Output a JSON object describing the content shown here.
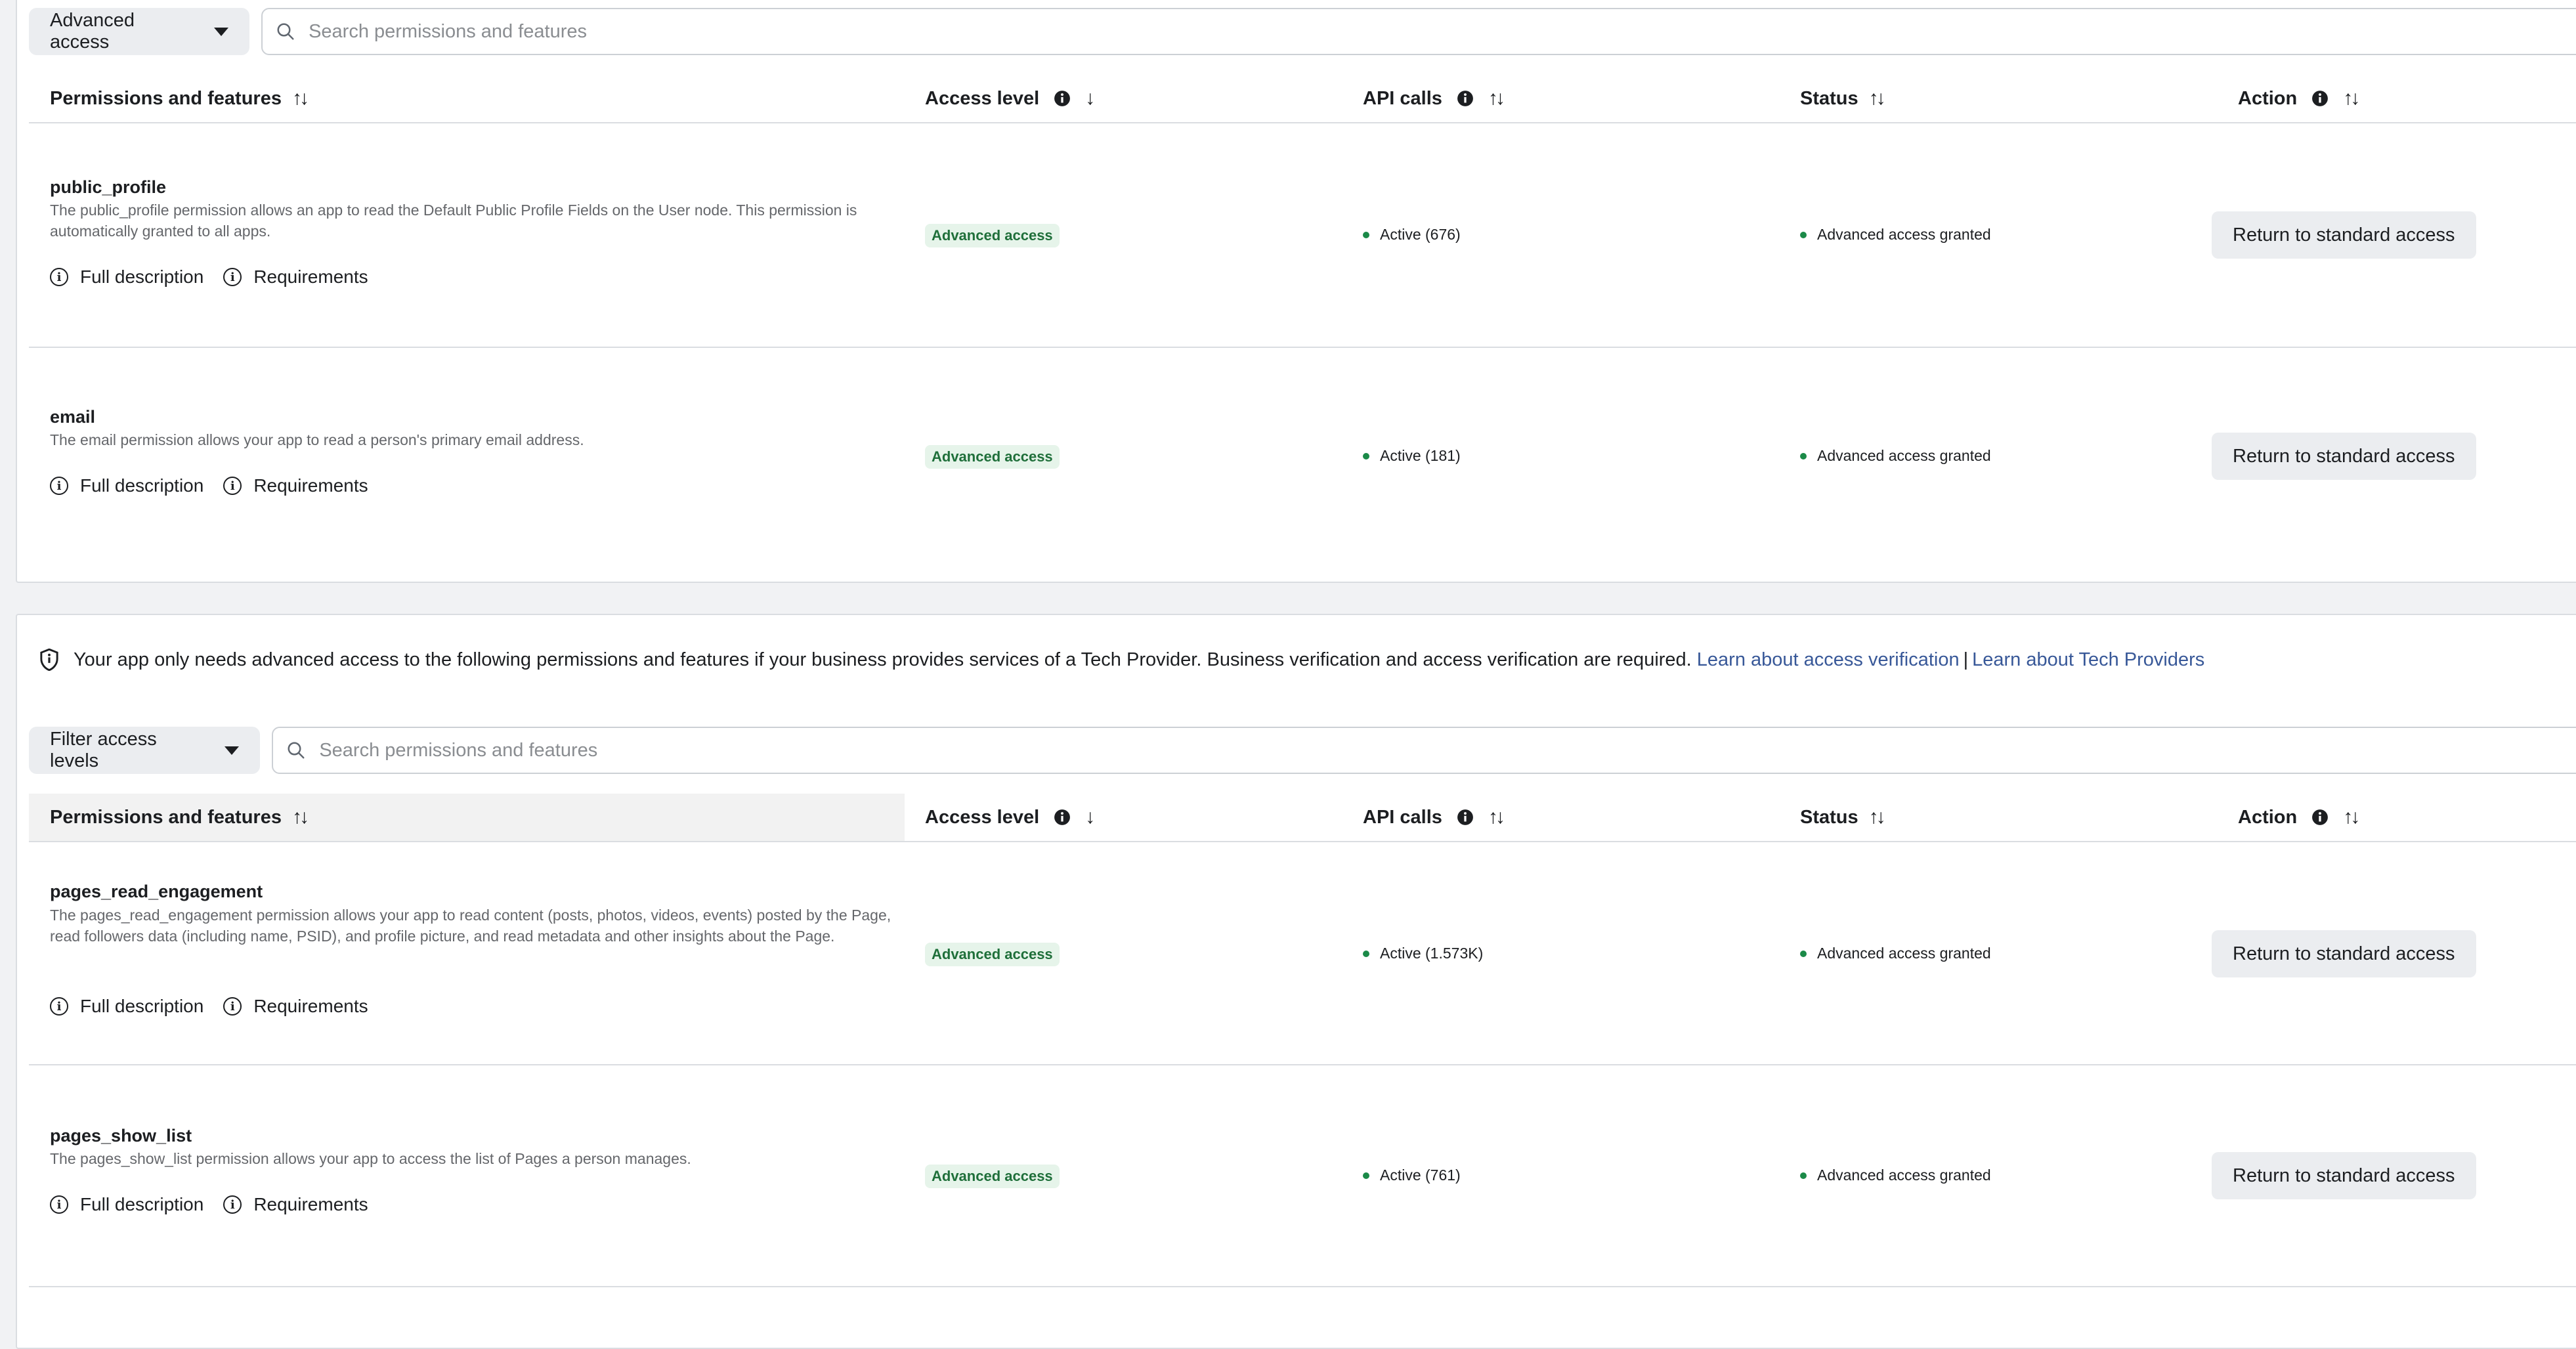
{
  "section1": {
    "filter_label": "Advanced access",
    "search_placeholder": "Search permissions and features",
    "columns": {
      "permissions": "Permissions and features",
      "access_level": "Access level",
      "api_calls": "API calls",
      "status": "Status",
      "action": "Action"
    },
    "rows": [
      {
        "name": "public_profile",
        "description": "The public_profile permission allows an app to read the Default Public Profile Fields on the User node. This permission is automatically granted to all apps.",
        "full_description": "Full description",
        "requirements": "Requirements",
        "access_level": "Advanced access",
        "api_calls": "Active (676)",
        "status": "Advanced access granted",
        "action": "Return to standard access"
      },
      {
        "name": "email",
        "description": "The email permission allows your app to read a person's primary email address.",
        "full_description": "Full description",
        "requirements": "Requirements",
        "access_level": "Advanced access",
        "api_calls": "Active (181)",
        "status": "Advanced access granted",
        "action": "Return to standard access"
      }
    ]
  },
  "section2": {
    "notice_text": "Your app only needs advanced access to the following permissions and features if your business provides services of a Tech Provider. Business verification and access verification are required.",
    "notice_link1": "Learn about access verification",
    "notice_separator": "|",
    "notice_link2": "Learn about Tech Providers",
    "filter_label": "Filter access levels",
    "search_placeholder": "Search permissions and features",
    "columns": {
      "permissions": "Permissions and features",
      "access_level": "Access level",
      "api_calls": "API calls",
      "status": "Status",
      "action": "Action"
    },
    "rows": [
      {
        "name": "pages_read_engagement",
        "description": "The pages_read_engagement permission allows your app to read content (posts, photos, videos, events) posted by the Page, read followers data (including name, PSID), and profile picture, and read metadata and other insights about the Page.",
        "full_description": "Full description",
        "requirements": "Requirements",
        "access_level": "Advanced access",
        "api_calls": "Active (1.573K)",
        "status": "Advanced access granted",
        "action": "Return to standard access"
      },
      {
        "name": "pages_show_list",
        "description": "The pages_show_list permission allows your app to access the list of Pages a person manages.",
        "full_description": "Full description",
        "requirements": "Requirements",
        "access_level": "Advanced access",
        "api_calls": "Active (761)",
        "status": "Advanced access granted",
        "action": "Return to standard access"
      }
    ]
  },
  "colors": {
    "accent_link": "#385898",
    "badge_bg": "#e6f4ea",
    "badge_text": "#1f6f3a",
    "status_dot": "#1b8a48"
  },
  "icons": [
    "search-icon",
    "info-icon",
    "sort-icon",
    "sort-down-icon",
    "caret-down-icon",
    "shield-icon",
    "info-circle-icon"
  ]
}
